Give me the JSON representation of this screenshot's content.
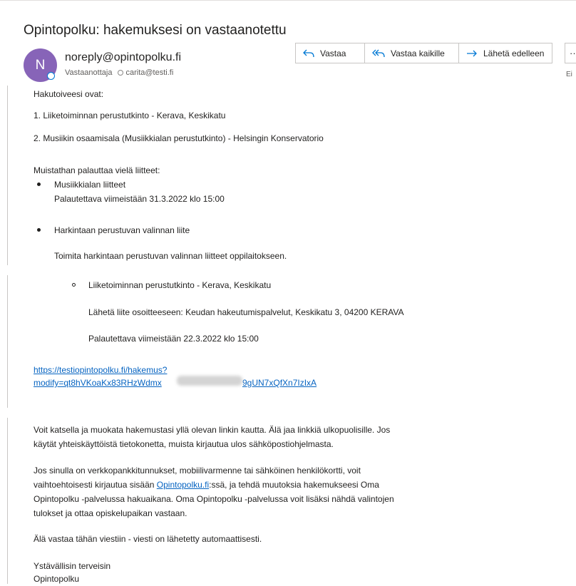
{
  "email": {
    "subject": "Opintopolku: hakemuksesi on vastaanotettu",
    "avatar_initial": "N",
    "sender": "noreply@opintopolku.fi",
    "recipient_label": "Vastaanottaja",
    "recipient": "carita@testi.fi",
    "truncated_status": "Ei"
  },
  "actions": {
    "reply": "Vastaa",
    "reply_all": "Vastaa kaikille",
    "forward": "Lähetä edelleen",
    "more": "···"
  },
  "body": {
    "intro": "Hakutoiveesi ovat:",
    "choice1": "1. Liiketoiminnan perustutkinto - Kerava, Keskikatu",
    "choice2": "2. Musiikin osaamisala (Musiikkialan perustutkinto) - Helsingin Konservatorio",
    "attachments_intro": "Muistathan palauttaa vielä liitteet:",
    "att1_title": "Musiikkialan liitteet",
    "att1_deadline": "Palautettava viimeistään 31.3.2022 klo 15:00",
    "att2_title": "Harkintaan perustuvan valinnan liite",
    "att2_instruction": "Toimita harkintaan perustuvan valinnan liitteet oppilaitokseen.",
    "sub_item": "Liiketoiminnan perustutkinto - Kerava, Keskikatu",
    "sub_address": "Lähetä liite osoitteeseen: Keudan hakeutumispalvelut, Keskikatu 3, 04200 KERAVA",
    "sub_deadline": "Palautettava viimeistään 22.3.2022 klo 15:00",
    "link_line1": "https://testiopintopolku.fi/hakemus?",
    "link_line2_start": "modify=qt8hVKoaKx83RHzWdmx",
    "link_line2_end": "9gUN7xQfXn7IzIxA",
    "para1_line1": "Voit katsella ja muokata hakemustasi yllä olevan linkin kautta. Älä jaa linkkiä ulkopuolisille. Jos",
    "para1_line2": "käytät yhteiskäyttöistä tietokonetta, muista kirjautua ulos sähköpostiohjelmasta.",
    "para2_line1": "Jos sinulla on verkkopankkitunnukset, mobiilivarmenne tai sähköinen henkilökortti, voit",
    "para2_line2_pre": "vaihtoehtoisesti kirjautua sisään ",
    "para2_link": "Opintopolku.fi",
    "para2_line2_post": ":ssä, ja tehdä muutoksia hakemukseesi Oma",
    "para2_line3": "Opintopolku -palvelussa hakuaikana. Oma Opintopolku -palvelussa voit lisäksi nähdä valintojen",
    "para2_line4": "tulokset ja ottaa opiskelupaikan vastaan.",
    "no_reply": "Älä vastaa tähän viestiin - viesti on lähetetty automaattisesti.",
    "closing": "Ystävällisin terveisin",
    "signature": "Opintopolku"
  },
  "colors": {
    "avatar": "#8764b8",
    "link": "#0563c1",
    "accent": "#0078d4"
  }
}
